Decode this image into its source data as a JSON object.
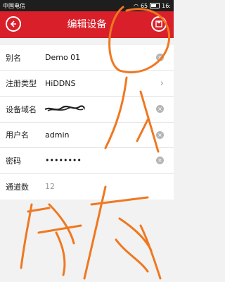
{
  "status_bar": {
    "carrier": "中国电信",
    "battery_label": "65",
    "time": "16:"
  },
  "header": {
    "title": "编辑设备",
    "back_icon": "back-circle-icon",
    "save_icon": "save-icon"
  },
  "form": {
    "rows": [
      {
        "label": "别名",
        "value": "Demo 01",
        "trailing": "clear-icon"
      },
      {
        "label": "注册类型",
        "value": "HiDDNS",
        "trailing": "chevron-right-icon"
      },
      {
        "label": "设备域名",
        "value": "",
        "trailing": "clear-icon"
      },
      {
        "label": "用户名",
        "value": "admin",
        "trailing": "clear-icon"
      },
      {
        "label": "密码",
        "value": "••••••••",
        "trailing": "clear-icon"
      },
      {
        "label": "通道数",
        "value": "12",
        "trailing": ""
      }
    ]
  },
  "annotation": {
    "color": "#f07820"
  },
  "colors": {
    "header": "#d9202a",
    "background": "#f2f2f2"
  }
}
